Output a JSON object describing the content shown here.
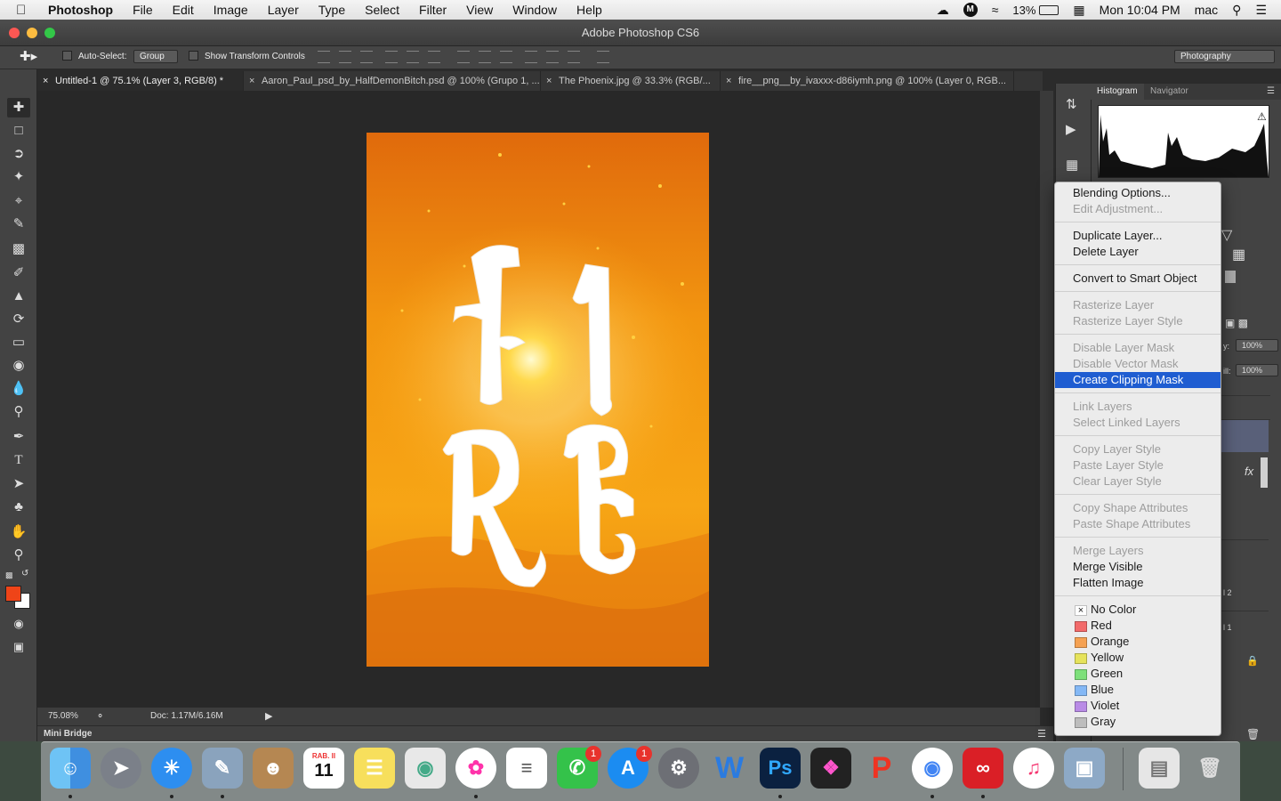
{
  "menubar": {
    "app_name": "Photoshop",
    "items": [
      "File",
      "Edit",
      "Image",
      "Layer",
      "Type",
      "Select",
      "Filter",
      "View",
      "Window",
      "Help"
    ],
    "battery": "13%",
    "clock": "Mon 10:04 PM",
    "user": "mac"
  },
  "window": {
    "title": "Adobe Photoshop CS6"
  },
  "options_bar": {
    "auto_select_label": "Auto-Select:",
    "auto_select_value": "Group",
    "show_transform_label": "Show Transform Controls",
    "workspace": "Photography"
  },
  "tabs": [
    {
      "label": "Untitled-1 @ 75.1% (Layer 3, RGB/8) *",
      "active": true
    },
    {
      "label": "Aaron_Paul_psd_by_HalfDemonBitch.psd @ 100% (Grupo 1, ..."
    },
    {
      "label": "The Phoenix.jpg @ 33.3% (RGB/..."
    },
    {
      "label": "fire__png__by_ivaxxx-d86iymh.png @ 100% (Layer 0, RGB..."
    }
  ],
  "status": {
    "zoom": "75.08%",
    "doc": "Doc: 1.17M/6.16M"
  },
  "mini_bridge": "Mini Bridge",
  "panels": {
    "histogram_tab": "Histogram",
    "navigator_tab": "Navigator",
    "opacity_label": "y:",
    "opacity_value": "100%",
    "fill_label": "ill:",
    "fill_value": "100%",
    "fx": "fx",
    "layer_label_a": "l 2",
    "layer_label_b": "l 1"
  },
  "context_menu": {
    "groups": [
      [
        {
          "label": "Blending Options...",
          "enabled": true
        },
        {
          "label": "Edit Adjustment...",
          "enabled": false
        }
      ],
      [
        {
          "label": "Duplicate Layer...",
          "enabled": true
        },
        {
          "label": "Delete Layer",
          "enabled": true
        }
      ],
      [
        {
          "label": "Convert to Smart Object",
          "enabled": true
        }
      ],
      [
        {
          "label": "Rasterize Layer",
          "enabled": false
        },
        {
          "label": "Rasterize Layer Style",
          "enabled": false
        }
      ],
      [
        {
          "label": "Disable Layer Mask",
          "enabled": false
        },
        {
          "label": "Disable Vector Mask",
          "enabled": false
        },
        {
          "label": "Create Clipping Mask",
          "enabled": true,
          "highlighted": true
        }
      ],
      [
        {
          "label": "Link Layers",
          "enabled": false
        },
        {
          "label": "Select Linked Layers",
          "enabled": false
        }
      ],
      [
        {
          "label": "Copy Layer Style",
          "enabled": false
        },
        {
          "label": "Paste Layer Style",
          "enabled": false
        },
        {
          "label": "Clear Layer Style",
          "enabled": false
        }
      ],
      [
        {
          "label": "Copy Shape Attributes",
          "enabled": false
        },
        {
          "label": "Paste Shape Attributes",
          "enabled": false
        }
      ],
      [
        {
          "label": "Merge Layers",
          "enabled": false
        },
        {
          "label": "Merge Visible",
          "enabled": true
        },
        {
          "label": "Flatten Image",
          "enabled": true
        }
      ]
    ],
    "colors": [
      {
        "label": "No Color",
        "swatch": "none"
      },
      {
        "label": "Red",
        "swatch": "#f26a6a"
      },
      {
        "label": "Orange",
        "swatch": "#f5a152"
      },
      {
        "label": "Yellow",
        "swatch": "#e6e35c"
      },
      {
        "label": "Green",
        "swatch": "#7de07a"
      },
      {
        "label": "Blue",
        "swatch": "#84b8f5"
      },
      {
        "label": "Violet",
        "swatch": "#b98be6"
      },
      {
        "label": "Gray",
        "swatch": "#bdbdbd"
      }
    ]
  },
  "canvas_text": "FIRE",
  "dock": {
    "calendar_month": "RAB. II",
    "calendar_day": "11",
    "facetime_badge": "1",
    "appstore_badge": "1"
  },
  "colors": {
    "foreground": "#ef4418",
    "background": "#ffffff",
    "highlight": "#1f5dd1"
  }
}
